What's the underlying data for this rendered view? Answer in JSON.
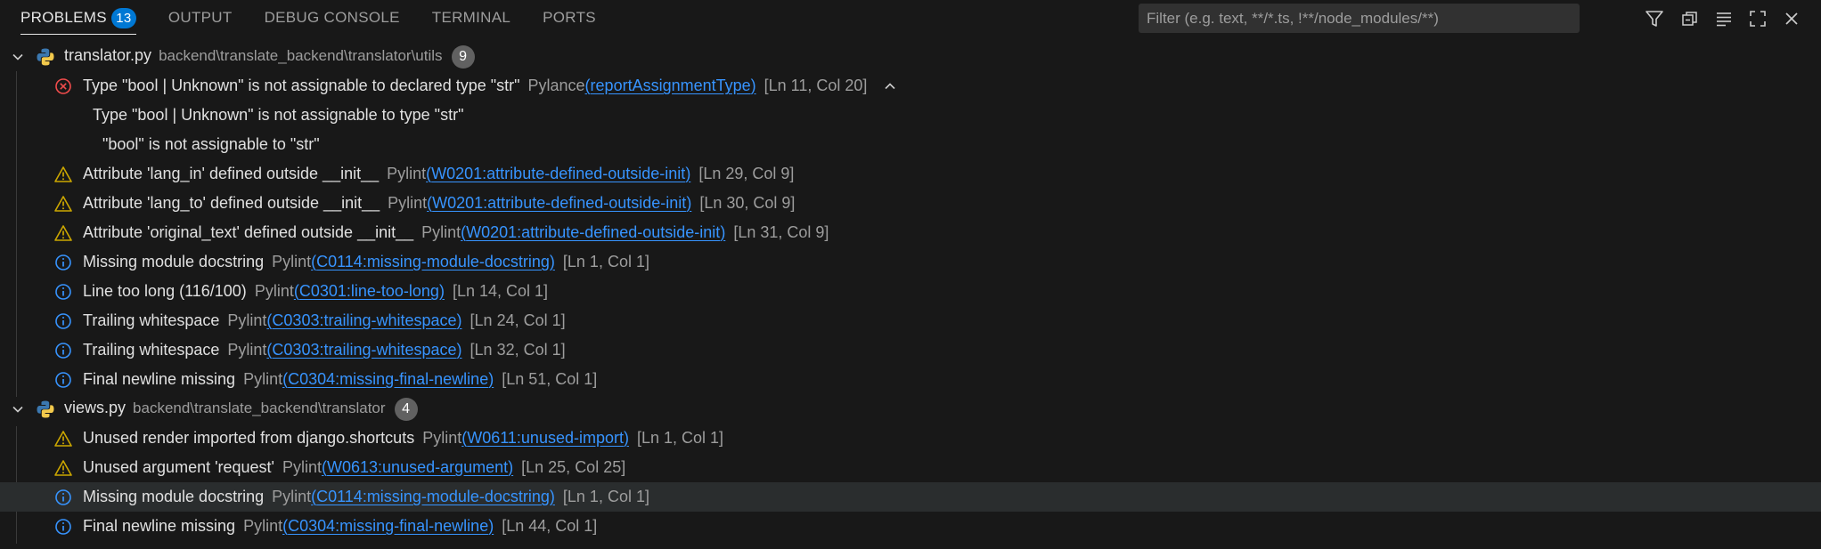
{
  "tabs": [
    {
      "label": "PROBLEMS",
      "badge": "13"
    },
    {
      "label": "OUTPUT"
    },
    {
      "label": "DEBUG CONSOLE"
    },
    {
      "label": "TERMINAL"
    },
    {
      "label": "PORTS"
    }
  ],
  "filter": {
    "placeholder": "Filter (e.g. text, **/*.ts, !**/node_modules/**)",
    "value": ""
  },
  "toolbar_icons": [
    "filter-icon",
    "collapse-all-icon",
    "view-as-list-icon",
    "maximize-panel-icon",
    "close-panel-icon"
  ],
  "colors": {
    "error": "#f14c4c",
    "warning": "#cca700",
    "info": "#3794ff",
    "link": "#3794ff",
    "accent": "#0078d4"
  },
  "files": [
    {
      "name": "translator.py",
      "path": "backend\\translate_backend\\translator\\utils",
      "count": "9",
      "problems": [
        {
          "severity": "error",
          "message": "Type \"bool | Unknown\" is not assignable to declared type \"str\"",
          "source": "Pylance",
          "code": "reportAssignmentType",
          "location": "[Ln 11, Col 20]",
          "details": [
            "Type \"bool | Unknown\" is not assignable to type \"str\"",
            "\"bool\" is not assignable to \"str\""
          ]
        },
        {
          "severity": "warning",
          "message": "Attribute 'lang_in' defined outside __init__",
          "source": "Pylint",
          "code": "W0201:attribute-defined-outside-init",
          "location": "[Ln 29, Col 9]"
        },
        {
          "severity": "warning",
          "message": "Attribute 'lang_to' defined outside __init__",
          "source": "Pylint",
          "code": "W0201:attribute-defined-outside-init",
          "location": "[Ln 30, Col 9]"
        },
        {
          "severity": "warning",
          "message": "Attribute 'original_text' defined outside __init__",
          "source": "Pylint",
          "code": "W0201:attribute-defined-outside-init",
          "location": "[Ln 31, Col 9]"
        },
        {
          "severity": "info",
          "message": "Missing module docstring",
          "source": "Pylint",
          "code": "C0114:missing-module-docstring",
          "location": "[Ln 1, Col 1]"
        },
        {
          "severity": "info",
          "message": "Line too long (116/100)",
          "source": "Pylint",
          "code": "C0301:line-too-long",
          "location": "[Ln 14, Col 1]"
        },
        {
          "severity": "info",
          "message": "Trailing whitespace",
          "source": "Pylint",
          "code": "C0303:trailing-whitespace",
          "location": "[Ln 24, Col 1]"
        },
        {
          "severity": "info",
          "message": "Trailing whitespace",
          "source": "Pylint",
          "code": "C0303:trailing-whitespace",
          "location": "[Ln 32, Col 1]"
        },
        {
          "severity": "info",
          "message": "Final newline missing",
          "source": "Pylint",
          "code": "C0304:missing-final-newline",
          "location": "[Ln 51, Col 1]"
        }
      ]
    },
    {
      "name": "views.py",
      "path": "backend\\translate_backend\\translator",
      "count": "4",
      "problems": [
        {
          "severity": "warning",
          "message": "Unused render imported from django.shortcuts",
          "source": "Pylint",
          "code": "W0611:unused-import",
          "location": "[Ln 1, Col 1]"
        },
        {
          "severity": "warning",
          "message": "Unused argument 'request'",
          "source": "Pylint",
          "code": "W0613:unused-argument",
          "location": "[Ln 25, Col 25]"
        },
        {
          "severity": "info",
          "message": "Missing module docstring",
          "source": "Pylint",
          "code": "C0114:missing-module-docstring",
          "location": "[Ln 1, Col 1]",
          "selected": true
        },
        {
          "severity": "info",
          "message": "Final newline missing",
          "source": "Pylint",
          "code": "C0304:missing-final-newline",
          "location": "[Ln 44, Col 1]"
        }
      ]
    }
  ]
}
